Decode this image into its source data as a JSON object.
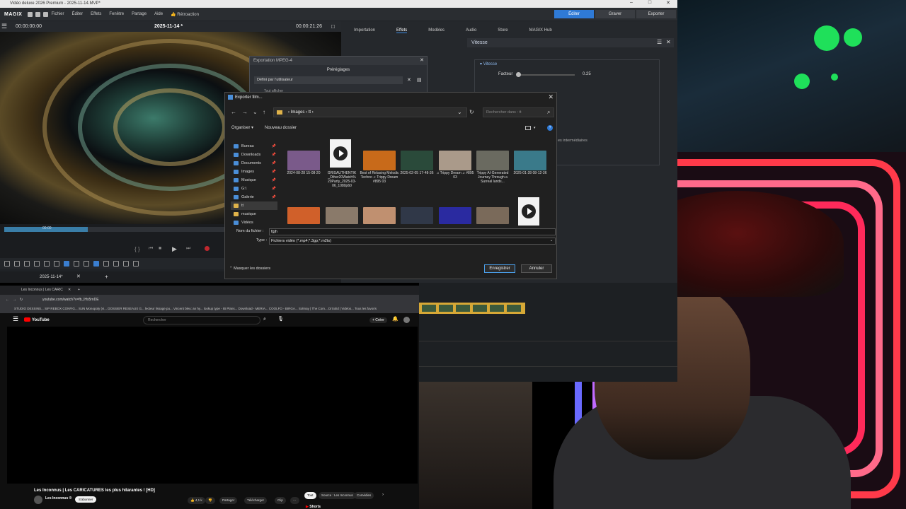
{
  "window": {
    "title": "Vidéo deluxe 2026 Premium - 2025-11-14.MVP*",
    "controls": [
      "–",
      "□",
      "✕"
    ]
  },
  "menu": {
    "logo": "MAGIX",
    "items": [
      "Fichier",
      "Éditer",
      "Effets",
      "Fenêtre",
      "Partage",
      "Aide"
    ],
    "retro": "Rétroaction"
  },
  "modes": {
    "edit": "Éditer",
    "burn": "Graver",
    "export": "Exporter"
  },
  "preview": {
    "time_left": "00:00:00:00",
    "project": "2025-11-14 *",
    "time_right": "00:00:21:26",
    "progress_fraction": 0.25,
    "progress_time": "00:00"
  },
  "project_tab": "2025-11-14*",
  "right_tabs": [
    "Importation",
    "Effets",
    "Modèles",
    "Audio",
    "Store",
    "MAGIX Hub"
  ],
  "vitesse": {
    "header": "Vitesse",
    "section": "Vitesse",
    "factor_label": "Facteur",
    "factor_value": "0.25",
    "note": "es intermédiaires"
  },
  "mpeg_dialog": {
    "title": "Exportation MPEG-4",
    "presets": "Préréglages",
    "preset_value": "Défini par l'utilisateur",
    "extra": "Tout afficher"
  },
  "save_dialog": {
    "title": "Exporter film...",
    "path": [
      "Images",
      "tt"
    ],
    "search_placeholder": "Rechercher dans : tt",
    "organize": "Organiser ▾",
    "new_folder": "Nouveau dossier",
    "sidebar": [
      {
        "label": "Bureau",
        "kind": "sys",
        "pinned": true
      },
      {
        "label": "Downloads",
        "kind": "sys",
        "pinned": true
      },
      {
        "label": "Documents",
        "kind": "sys",
        "pinned": true
      },
      {
        "label": "Images",
        "kind": "sys",
        "pinned": true
      },
      {
        "label": "Musique",
        "kind": "sys",
        "pinned": true
      },
      {
        "label": "G:\\",
        "kind": "sys",
        "pinned": true
      },
      {
        "label": "Galerie",
        "kind": "sys",
        "pinned": true
      },
      {
        "label": "tt",
        "kind": "folder",
        "pinned": false
      },
      {
        "label": "musique",
        "kind": "folder",
        "pinned": false
      },
      {
        "label": "Vidéos",
        "kind": "sys",
        "pinned": false
      }
    ],
    "files": [
      {
        "label": "2024-08-28 15-08-20",
        "color": "#7a5a8a"
      },
      {
        "label": "GRISAUTHENTIK _Other20Watch% 20Party_2025-03- 06_1080p60",
        "color": "play"
      },
      {
        "label": "Best of Relaxing Melodic Techno ♫ Trippy Dream #895 03",
        "color": "#c86a1a"
      },
      {
        "label": "2025-02-05 17-48-36",
        "color": "#2a4a3a"
      },
      {
        "label": "♫ Trippy Dream ♫ #895 03",
        "color": "#aa9a8a"
      },
      {
        "label": "Trippy AI-Generated Journey Through a Surreal lands...",
        "color": "#6a6a60"
      },
      {
        "label": "2025-01-28 08-12-36",
        "color": "#3a7a8a"
      }
    ],
    "row2_colors": [
      "#d0602a",
      "#8a7a6a",
      "#c09070",
      "#303848",
      "#2a2aa0",
      "#7a6a5a",
      "play"
    ],
    "filename_label": "Nom du fichier :",
    "filename_value": "fgjh",
    "type_label": "Type :",
    "type_value": "Fichiers vidéo (*.mp4;*.3gp;*.m2ts)",
    "hide_folders": "Masquer les dossiers",
    "save": "Enregistrer",
    "cancel": "Annuler"
  },
  "browser": {
    "tab": "Les Inconnus | Les CARIC",
    "url": "youtube.com/watch?v=fb_lHs5rnDE",
    "bookmarks": "STUDIO DESSINS...   SIP REBOX CONFIG...   SUN Monopoly (vi...   DOSSIER RESEAUX G...   lecteur lissage pu...   Vincent bleu: an hy...   lookup type - IB Plans...   Download - MERIA...   COOLFO - BIRGA...   Solmay | The Com...   DrSolid | Vidéos...   Tous les favoris",
    "yt_logo": "YouTube",
    "yt_search": "Rechercher",
    "create": "+ Créer",
    "video_title": "Les Inconnus | Les CARICATURES les plus hilarantes ! [HD]",
    "channel": "Les Inconnus ®",
    "subscribe": "S'abonner",
    "likes": "4,1 k",
    "actions": [
      "Partager",
      "Télécharger",
      "Clip"
    ],
    "chips": [
      "Tout",
      "Source : Les Inconnus",
      "Comédies"
    ],
    "shorts": "Shorts"
  }
}
